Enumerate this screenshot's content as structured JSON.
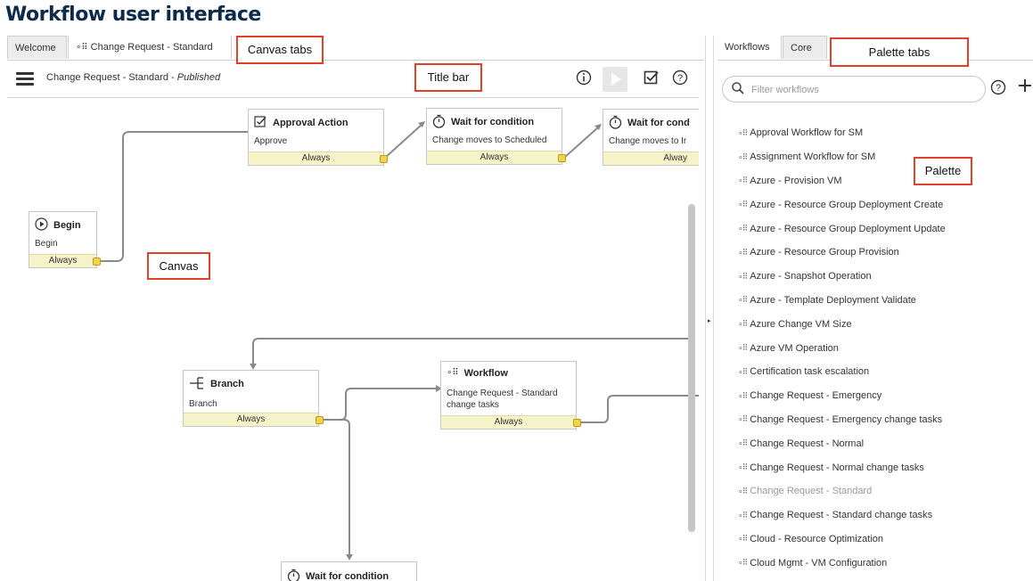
{
  "page_heading": "Workflow user interface",
  "canvas_tabs": {
    "tabs": [
      {
        "label": "Welcome",
        "active": false
      },
      {
        "label": "Change Request - Standard",
        "active": true,
        "icon": "workflow-icon"
      }
    ]
  },
  "callouts": {
    "canvas_tabs": "Canvas tabs",
    "title_bar": "Title bar",
    "canvas": "Canvas",
    "palette_tabs": "Palette tabs",
    "palette": "Palette"
  },
  "title_bar": {
    "workflow_name": "Change Request - Standard",
    "separator": " - ",
    "status": "Published",
    "icons": [
      "menu-icon",
      "info-icon",
      "run-icon",
      "checkbox-icon",
      "help-icon"
    ]
  },
  "canvas": {
    "nodes": [
      {
        "id": "begin",
        "title": "Begin",
        "subtitle": "Begin",
        "footer": "Always",
        "icon": "play-icon"
      },
      {
        "id": "approval",
        "title": "Approval Action",
        "subtitle": "Approve",
        "footer": "Always",
        "icon": "approval-icon"
      },
      {
        "id": "wait1",
        "title": "Wait for condition",
        "subtitle": "Change moves to Scheduled",
        "footer": "Always",
        "icon": "timer-icon"
      },
      {
        "id": "wait2",
        "title": "Wait for cond",
        "subtitle": "Change moves to Ir",
        "footer": "Alway",
        "icon": "timer-icon"
      },
      {
        "id": "branch",
        "title": "Branch",
        "subtitle": "Branch",
        "footer": "Always",
        "icon": "branch-icon"
      },
      {
        "id": "workflow",
        "title": "Workflow",
        "subtitle_line1": "Change Request - Standard",
        "subtitle_line2": "change tasks",
        "footer": "Always",
        "icon": "workflow-icon"
      },
      {
        "id": "wait3",
        "title": "Wait for condition",
        "icon": "timer-icon"
      }
    ]
  },
  "palette_tabs": {
    "tabs": [
      {
        "label": "Workflows",
        "active": true
      },
      {
        "label": "Core",
        "active": false
      }
    ]
  },
  "palette": {
    "filter_placeholder": "Filter workflows",
    "filter_value": "",
    "items": [
      {
        "label": "Approval Workflow for SM",
        "dim": false
      },
      {
        "label": "Assignment Workflow for SM",
        "dim": false
      },
      {
        "label": "Azure - Provision VM",
        "dim": false
      },
      {
        "label": "Azure - Resource Group Deployment Create",
        "dim": false
      },
      {
        "label": "Azure - Resource Group Deployment Update",
        "dim": false
      },
      {
        "label": "Azure - Resource Group Provision",
        "dim": false
      },
      {
        "label": "Azure - Snapshot Operation",
        "dim": false
      },
      {
        "label": "Azure - Template Deployment Validate",
        "dim": false
      },
      {
        "label": "Azure Change VM Size",
        "dim": false
      },
      {
        "label": "Azure VM Operation",
        "dim": false
      },
      {
        "label": "Certification task escalation",
        "dim": false
      },
      {
        "label": "Change Request - Emergency",
        "dim": false
      },
      {
        "label": "Change Request - Emergency change tasks",
        "dim": false
      },
      {
        "label": "Change Request - Normal",
        "dim": false
      },
      {
        "label": "Change Request - Normal change tasks",
        "dim": false
      },
      {
        "label": "Change Request - Standard",
        "dim": true
      },
      {
        "label": "Change Request - Standard change tasks",
        "dim": false
      },
      {
        "label": "Cloud - Resource Optimization",
        "dim": false
      },
      {
        "label": "Cloud Mgmt - VM Configuration",
        "dim": false
      }
    ]
  }
}
